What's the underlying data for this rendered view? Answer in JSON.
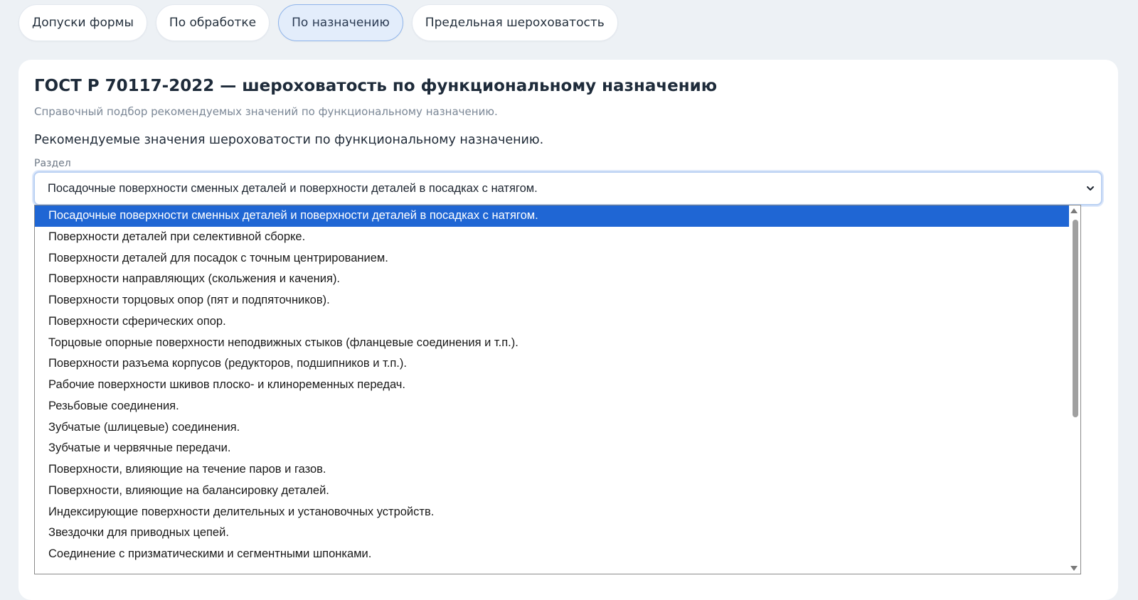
{
  "tabs": [
    {
      "label": "Допуски формы",
      "active": false
    },
    {
      "label": "По обработке",
      "active": false
    },
    {
      "label": "По назначению",
      "active": true
    },
    {
      "label": "Предельная шероховатость",
      "active": false
    }
  ],
  "card": {
    "title": "ГОСТ Р 70117-2022 — шероховатость по функциональному назначению",
    "subtitle": "Справочный подбор рекомендуемых значений по функциональному назначению.",
    "description": "Рекомендуемые значения шероховатости по функциональному назначению."
  },
  "section_select": {
    "label": "Раздел",
    "value": "Посадочные поверхности сменных деталей и поверхности деталей в посадках с натягом.",
    "icon": "chevron-down-icon"
  },
  "dropdown": {
    "options": [
      "Посадочные поверхности сменных деталей и поверхности деталей в посадках с натягом.",
      "Поверхности деталей при селективной сборке.",
      "Поверхности деталей для посадок с точным центрированием.",
      "Поверхности направляющих (скольжения и качения).",
      "Поверхности торцовых опор (пят и подпяточников).",
      "Поверхности сферических опор.",
      "Торцовые опорные поверхности неподвижных стыков (фланцевые соединения и т.п.).",
      "Поверхности разъема корпусов (редукторов, подшипников и т.п.).",
      "Рабочие поверхности шкивов плоско- и клиноременных передач.",
      "Резьбовые соединения.",
      "Зубчатые (шлицевые) соединения.",
      "Зубчатые и червячные передачи.",
      "Поверхности, влияющие на течение паров и газов.",
      "Поверхности, влияющие на балансировку деталей.",
      "Индексирующие поверхности делительных и установочных устройств.",
      "Звездочки для приводных цепей.",
      "Соединение с призматическими и сегментными шпонками."
    ],
    "selected_index": 0
  },
  "colors": {
    "background": "#edf1f5",
    "card": "#ffffff",
    "active_tab_bg": "#e3edfb",
    "active_tab_border": "#8fb4ea",
    "selected_option": "#1f66d4"
  }
}
